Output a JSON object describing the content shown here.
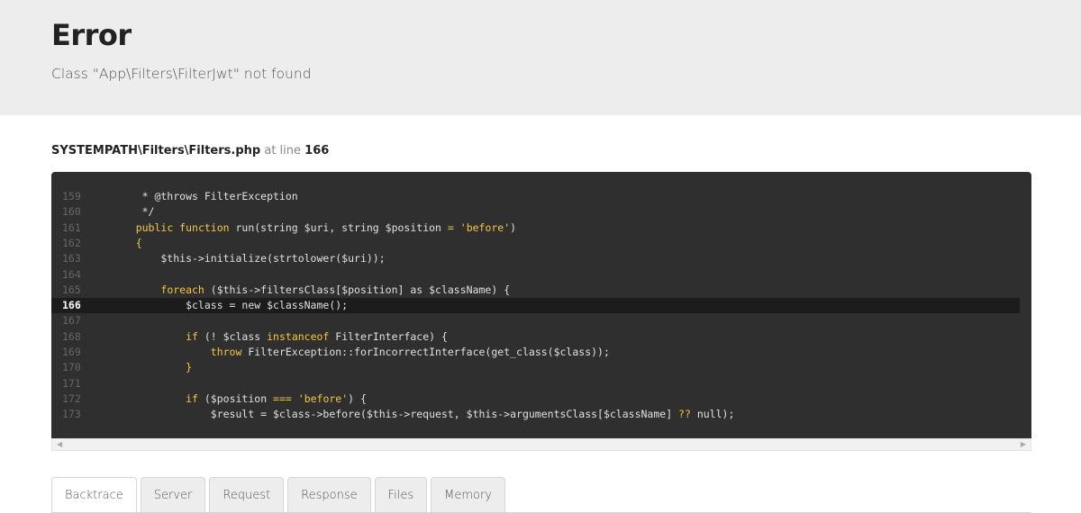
{
  "header": {
    "title": "Error",
    "message": "Class \"App\\Filters\\FilterJwt\" not found"
  },
  "location": {
    "path": "SYSTEMPATH\\Filters\\Filters.php",
    "at_text": "at line",
    "line": "166"
  },
  "source": {
    "highlight_line": "166",
    "lines": [
      {
        "n": "159",
        "segments": [
          {
            "t": "     * @throws FilterException",
            "c": "cm"
          }
        ]
      },
      {
        "n": "160",
        "segments": [
          {
            "t": "     */",
            "c": "cm"
          }
        ]
      },
      {
        "n": "161",
        "segments": [
          {
            "t": "    ",
            "c": ""
          },
          {
            "t": "public function",
            "c": "kw"
          },
          {
            "t": " run(string $uri, string $position ",
            "c": ""
          },
          {
            "t": "=",
            "c": "op"
          },
          {
            "t": " ",
            "c": ""
          },
          {
            "t": "'before'",
            "c": "str"
          },
          {
            "t": ")",
            "c": ""
          }
        ]
      },
      {
        "n": "162",
        "segments": [
          {
            "t": "    {",
            "c": "kw"
          }
        ]
      },
      {
        "n": "163",
        "segments": [
          {
            "t": "        $this->initialize(strtolower($uri));",
            "c": ""
          }
        ]
      },
      {
        "n": "164",
        "segments": [
          {
            "t": "",
            "c": ""
          }
        ]
      },
      {
        "n": "165",
        "segments": [
          {
            "t": "        ",
            "c": ""
          },
          {
            "t": "foreach",
            "c": "kw"
          },
          {
            "t": " ($this->filtersClass[$position] as $className) {",
            "c": ""
          }
        ]
      },
      {
        "n": "166",
        "segments": [
          {
            "t": "            $class = new $className();",
            "c": ""
          }
        ]
      },
      {
        "n": "167",
        "segments": [
          {
            "t": "",
            "c": ""
          }
        ]
      },
      {
        "n": "168",
        "segments": [
          {
            "t": "            ",
            "c": ""
          },
          {
            "t": "if",
            "c": "kw"
          },
          {
            "t": " (! $class ",
            "c": ""
          },
          {
            "t": "instanceof",
            "c": "kw"
          },
          {
            "t": " FilterInterface) {",
            "c": ""
          }
        ]
      },
      {
        "n": "169",
        "segments": [
          {
            "t": "                ",
            "c": ""
          },
          {
            "t": "throw",
            "c": "kw"
          },
          {
            "t": " FilterException::forIncorrectInterface(get_class($class));",
            "c": ""
          }
        ]
      },
      {
        "n": "170",
        "segments": [
          {
            "t": "            }",
            "c": "kw"
          }
        ]
      },
      {
        "n": "171",
        "segments": [
          {
            "t": "",
            "c": ""
          }
        ]
      },
      {
        "n": "172",
        "segments": [
          {
            "t": "            ",
            "c": ""
          },
          {
            "t": "if",
            "c": "kw"
          },
          {
            "t": " ($position ",
            "c": ""
          },
          {
            "t": "===",
            "c": "op"
          },
          {
            "t": " ",
            "c": ""
          },
          {
            "t": "'before'",
            "c": "str"
          },
          {
            "t": ") {",
            "c": ""
          }
        ]
      },
      {
        "n": "173",
        "segments": [
          {
            "t": "                $result = $class->before($this->request, $this->argumentsClass[$className] ",
            "c": ""
          },
          {
            "t": "??",
            "c": "op"
          },
          {
            "t": " null);",
            "c": ""
          }
        ]
      }
    ]
  },
  "tabs": [
    {
      "label": "Backtrace",
      "active": true
    },
    {
      "label": "Server",
      "active": false
    },
    {
      "label": "Request",
      "active": false
    },
    {
      "label": "Response",
      "active": false
    },
    {
      "label": "Files",
      "active": false
    },
    {
      "label": "Memory",
      "active": false
    }
  ],
  "colors": {
    "header_bg": "#ededed",
    "code_bg": "#2f2f2f",
    "code_highlight_bg": "#1c1c1c",
    "keyword": "#f6c744"
  },
  "icons": {
    "scroll_left": "scroll-left-arrow-icon",
    "scroll_right": "scroll-right-arrow-icon"
  }
}
